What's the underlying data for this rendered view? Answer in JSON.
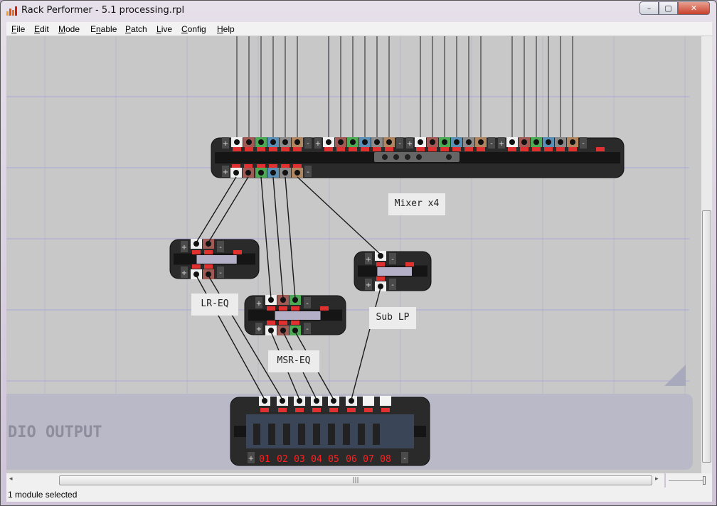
{
  "window": {
    "title": "Rack Performer - 5.1 processing.rpl",
    "controls": [
      "minimize",
      "maximize",
      "close"
    ]
  },
  "menu": [
    {
      "label": "File",
      "u": "F",
      "rest": "ile"
    },
    {
      "label": "Edit",
      "u": "E",
      "rest": "dit"
    },
    {
      "label": "Mode",
      "u": "M",
      "rest": "ode"
    },
    {
      "label": "Enable",
      "pre": "E",
      "u": "n",
      "rest": "able"
    },
    {
      "label": "Patch",
      "u": "P",
      "rest": "atch"
    },
    {
      "label": "Live",
      "u": "L",
      "rest": "ive"
    },
    {
      "label": "Config",
      "u": "C",
      "rest": "onfig"
    },
    {
      "label": "Help",
      "u": "H",
      "rest": "elp"
    }
  ],
  "modules": {
    "mixer": {
      "label": "Mixer x4"
    },
    "lr_eq": {
      "label": "LR-EQ"
    },
    "msr_eq": {
      "label": "MSR-EQ"
    },
    "sub_lp": {
      "label": "Sub LP"
    },
    "output": {
      "panel_title": "DIO OUTPUT",
      "channels": [
        "01",
        "02",
        "03",
        "04",
        "05",
        "06",
        "07",
        "08"
      ]
    }
  },
  "jack_colors": [
    "#f0f0f0",
    "#a05a55",
    "#4caa55",
    "#5a8fb5",
    "#8a8a8a",
    "#b08660"
  ],
  "status": {
    "text": "1 module selected"
  }
}
